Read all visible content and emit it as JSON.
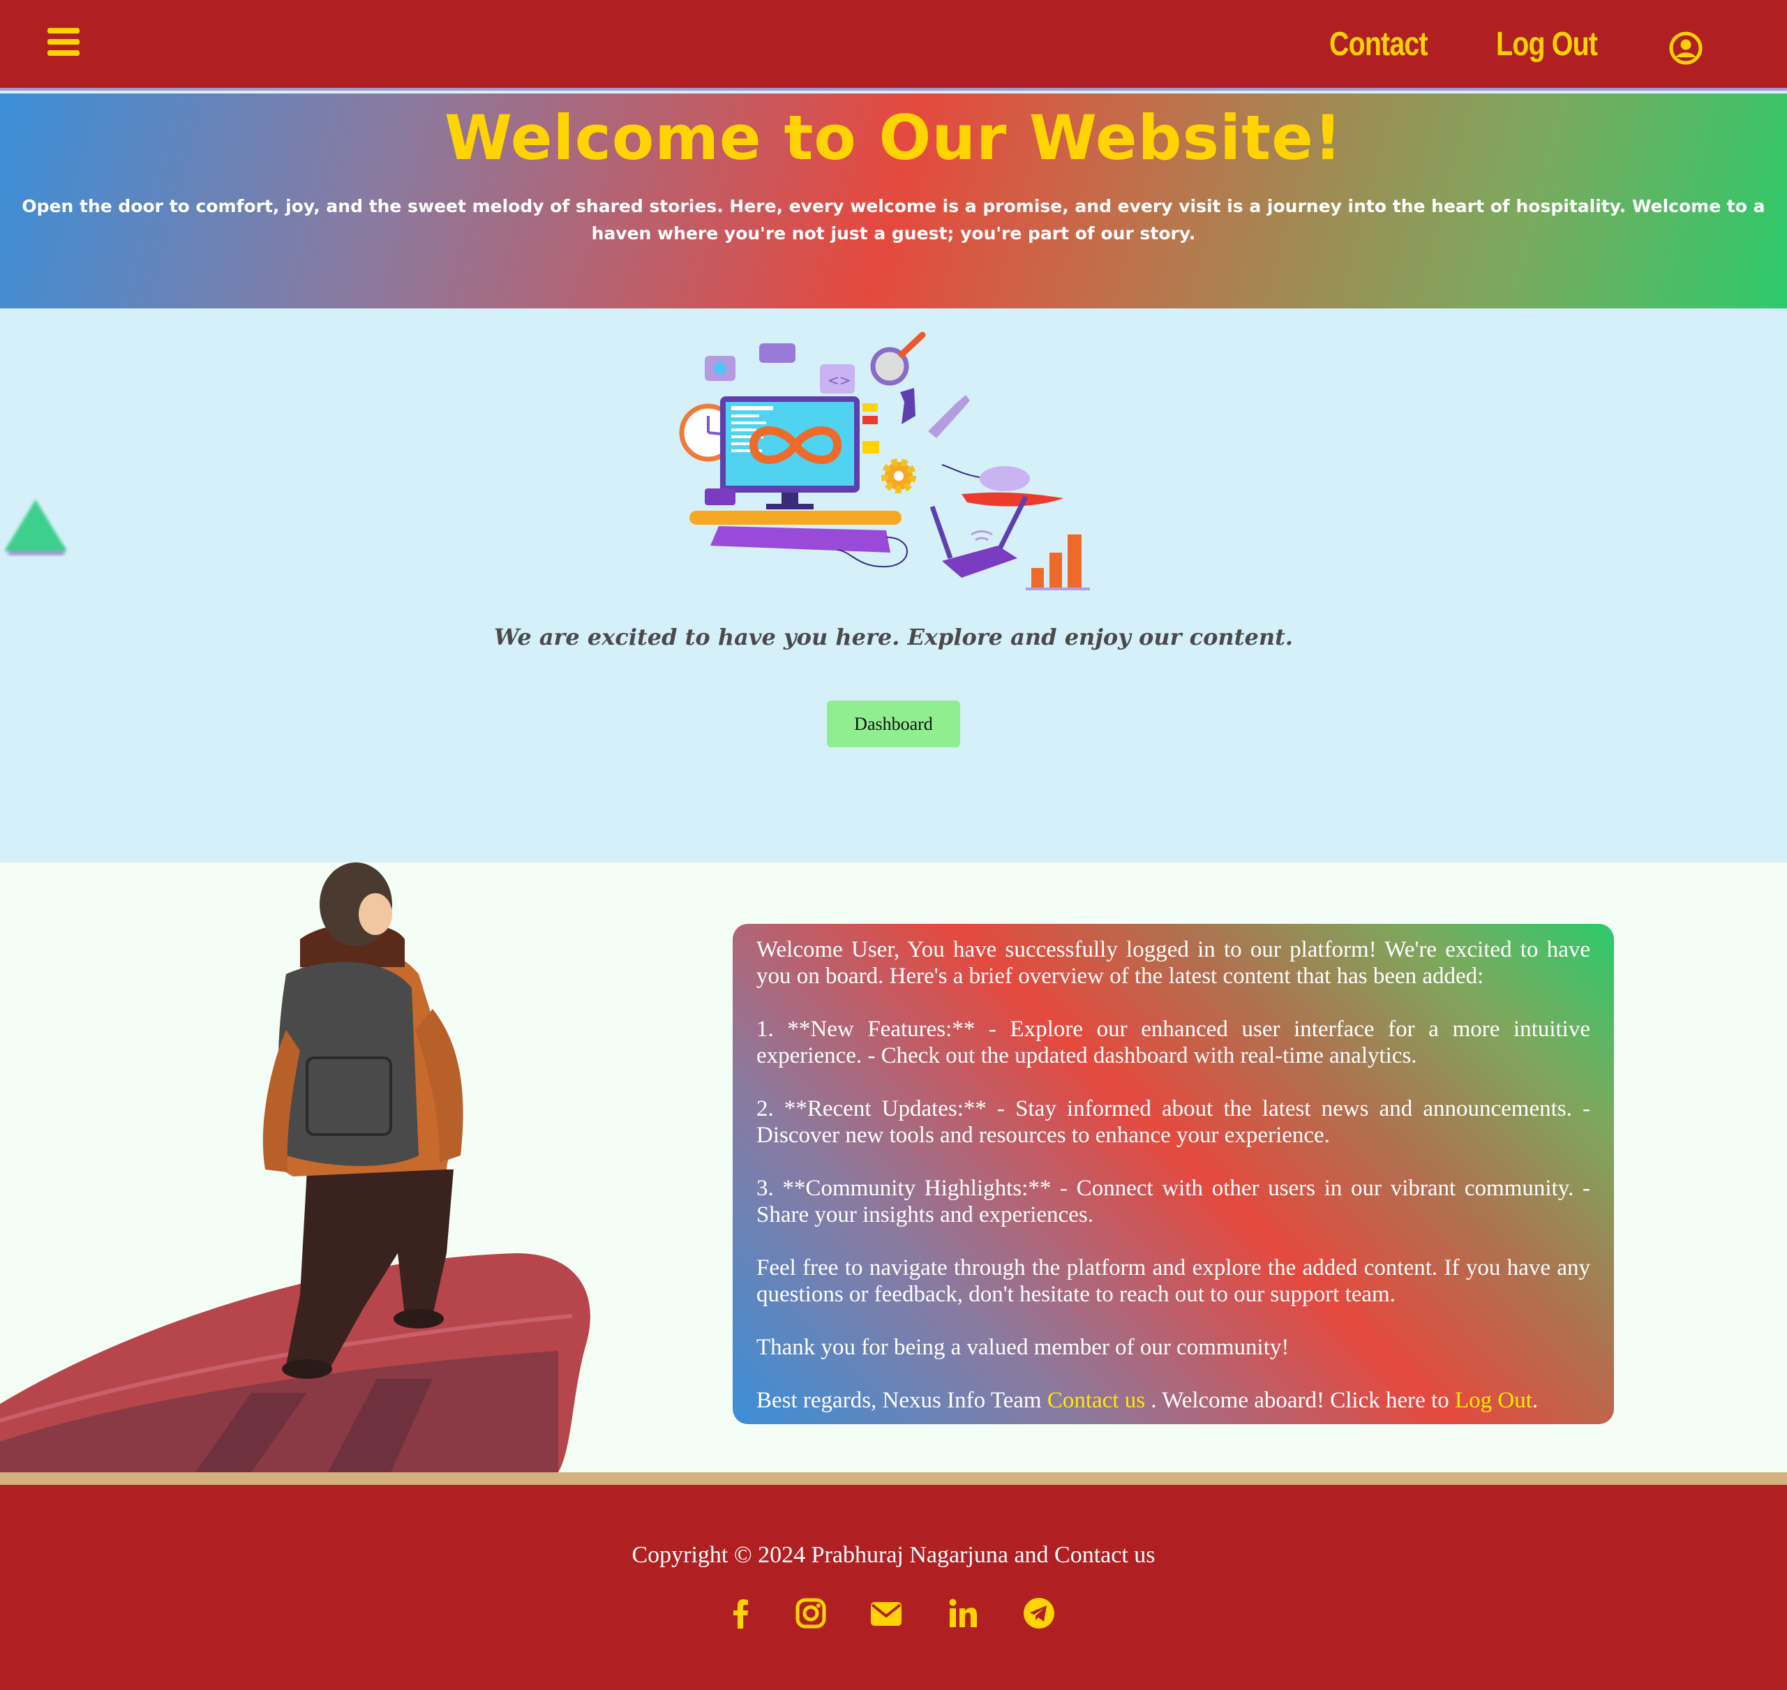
{
  "nav": {
    "menu_icon": "hamburger-menu-icon",
    "contact_label": "Contact",
    "logout_label": "Log Out",
    "user_icon": "user-circle-icon"
  },
  "hero": {
    "title": "Welcome to Our Website!",
    "text": "Open the door to comfort, joy, and the sweet melody of shared stories. Here, every welcome is a promise, and every visit is a journey into the heart of hospitality. Welcome to a haven where you're not just a guest; you're part of our story."
  },
  "welcome": {
    "tagline": "We are excited to have you here. Explore and enjoy our content.",
    "dashboard_label": "Dashboard"
  },
  "info": {
    "p1": "Welcome User, You have successfully logged in to our platform! We're excited to have you on board. Here's a brief overview of the latest content that has been added:",
    "p2": "1. **New Features:** - Explore our enhanced user interface for a more intuitive experience. - Check out the updated dashboard with real-time analytics.",
    "p3": "2. **Recent Updates:** - Stay informed about the latest news and announcements. - Discover new tools and resources to enhance your experience.",
    "p4": "3. **Community Highlights:** - Connect with other users in our vibrant community. - Share your insights and experiences.",
    "p5": "Feel free to navigate through the platform and explore the added content. If you have any questions or feedback, don't hesitate to reach out to our support team.",
    "p6": "Thank you for being a valued member of our community!",
    "p7_pre": "Best regards, Nexus Info Team ",
    "p7_contact": "Contact us",
    "p7_mid": " . Welcome aboard! Click here to ",
    "p7_logout": "Log Out",
    "p7_post": "."
  },
  "footer": {
    "copyright": "Copyright © 2024 Prabhuraj Nagarjuna and Contact us",
    "socials": [
      "facebook-icon",
      "instagram-icon",
      "email-icon",
      "linkedin-icon",
      "telegram-icon"
    ]
  },
  "colors": {
    "nav_bg": "#b01f22",
    "accent_yellow": "#ffd400",
    "welcome_bg": "#d6f0fa",
    "button_green": "#90ee90",
    "footer_band": "#d4b27f"
  }
}
